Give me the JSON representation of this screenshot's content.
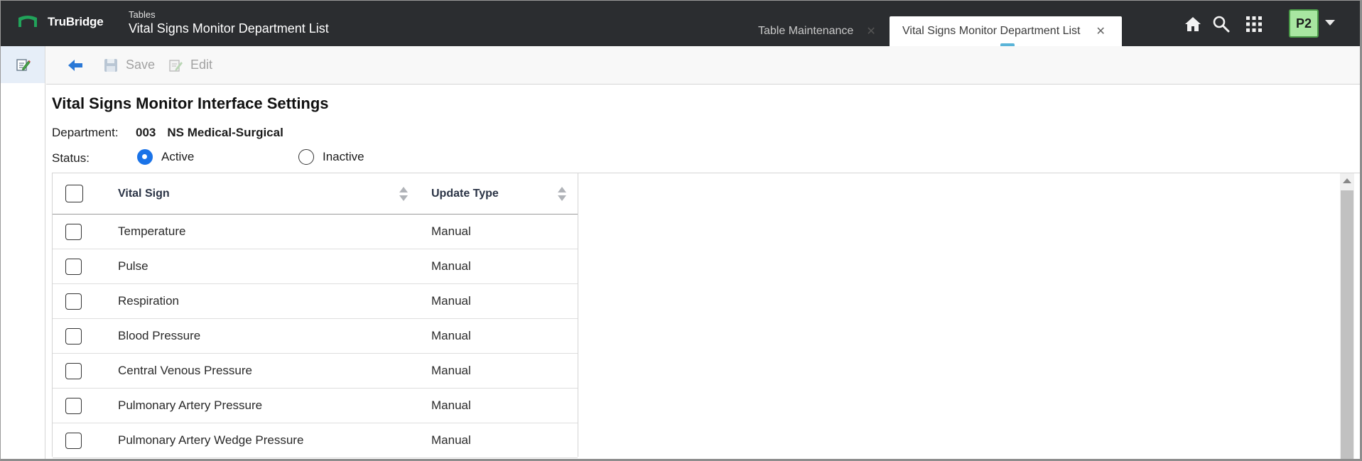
{
  "header": {
    "logo_text": "TruBridge",
    "app_subtitle": "Tables",
    "app_title": "Vital Signs Monitor Department List",
    "tabs": [
      {
        "label": "Table Maintenance",
        "active": false,
        "close": "✕"
      },
      {
        "label": "Vital Signs Monitor Department List",
        "active": true,
        "close": "✕"
      }
    ],
    "icons": [
      "home-icon",
      "search-icon",
      "apps-grid-icon"
    ],
    "avatar_label": "P2",
    "colors": {
      "bar": "#2b2d30",
      "avatar_bg": "#a8e6a1",
      "logo_green": "#21a35a"
    }
  },
  "left_rail": {
    "items": [
      {
        "icon": "edit-notes-icon",
        "active": true
      }
    ]
  },
  "toolbar": {
    "back_icon": "back-arrow-icon",
    "save_label": "Save",
    "edit_label": "Edit"
  },
  "main": {
    "title": "Vital Signs Monitor Interface Settings",
    "department_label": "Department:",
    "department_code": "003",
    "department_name": "NS Medical-Surgical",
    "status_label": "Status:",
    "status_options": [
      {
        "label": "Active",
        "checked": true
      },
      {
        "label": "Inactive",
        "checked": false
      }
    ],
    "grid": {
      "columns": [
        "Vital Sign",
        "Update Type"
      ],
      "rows": [
        {
          "vital_sign": "Temperature",
          "update_type": "Manual"
        },
        {
          "vital_sign": "Pulse",
          "update_type": "Manual"
        },
        {
          "vital_sign": "Respiration",
          "update_type": "Manual"
        },
        {
          "vital_sign": "Blood Pressure",
          "update_type": "Manual"
        },
        {
          "vital_sign": "Central Venous Pressure",
          "update_type": "Manual"
        },
        {
          "vital_sign": "Pulmonary Artery Pressure",
          "update_type": "Manual"
        },
        {
          "vital_sign": "Pulmonary Artery Wedge Pressure",
          "update_type": "Manual"
        }
      ]
    },
    "accent_color": "#1a73e8"
  }
}
